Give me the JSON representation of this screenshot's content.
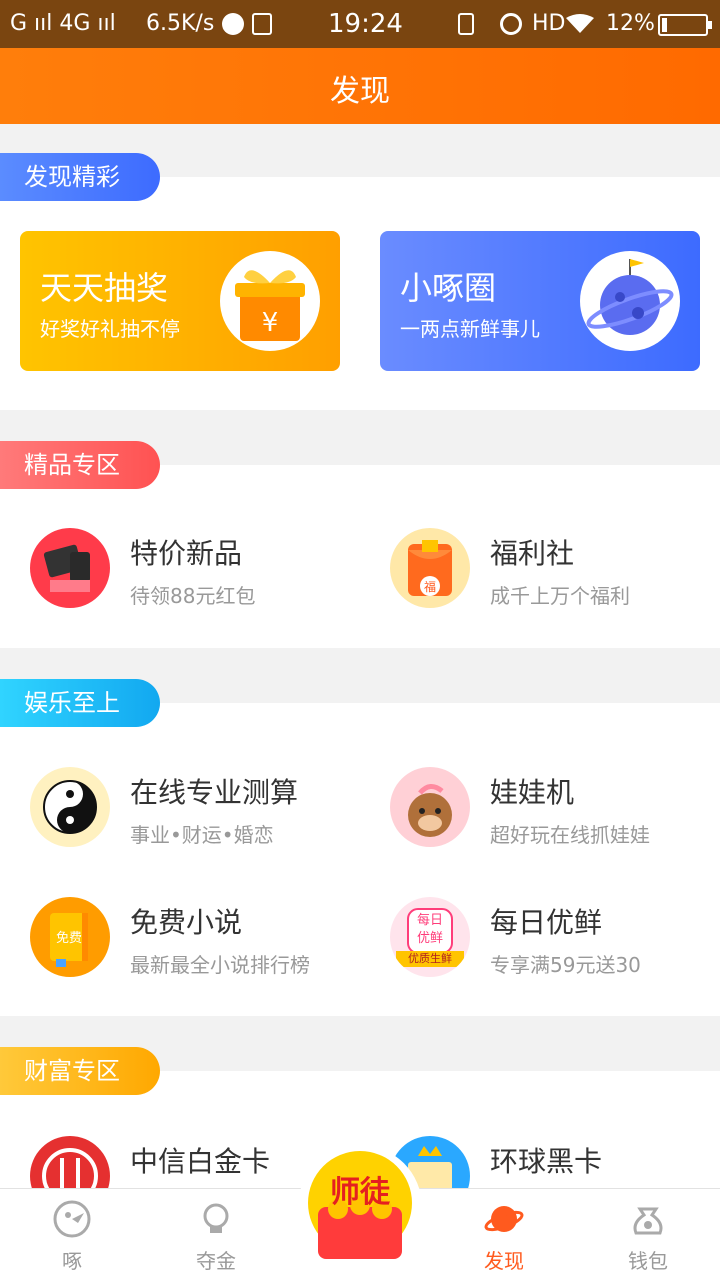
{
  "status_bar": {
    "signal_left": "G ııl 4G ııl",
    "speed": "6.5K/s",
    "time": "19:24",
    "hd": "HD",
    "battery": "12%",
    "battery_level": 0.12
  },
  "header": {
    "title": "发现"
  },
  "sections": {
    "discover": {
      "label": "发现精彩"
    },
    "premium": {
      "label": "精品专区"
    },
    "entertainment": {
      "label": "娱乐至上"
    },
    "wealth": {
      "label": "财富专区"
    }
  },
  "discover_cards": [
    {
      "title": "天天抽奖",
      "subtitle": "好奖好礼抽不停",
      "icon": "gift-icon",
      "color": "#ffb400"
    },
    {
      "title": "小啄圈",
      "subtitle": "一两点新鲜事儿",
      "icon": "planet-icon",
      "color": "#4a7bff"
    }
  ],
  "premium_items": [
    {
      "title": "特价新品",
      "subtitle": "待领88元红包",
      "icon": "gadgets-icon"
    },
    {
      "title": "福利社",
      "subtitle": "成千上万个福利",
      "icon": "red-envelope-icon"
    }
  ],
  "entertainment_items": [
    {
      "title": "在线专业测算",
      "subtitle": "事业•财运•婚恋",
      "icon": "yin-yang-icon"
    },
    {
      "title": "娃娃机",
      "subtitle": "超好玩在线抓娃娃",
      "icon": "plush-bear-icon"
    },
    {
      "title": "免费小说",
      "subtitle": "最新最全小说排行榜",
      "icon": "book-icon",
      "badge": "免费"
    },
    {
      "title": "每日优鲜",
      "subtitle": "专享满59元送30",
      "icon": "fresh-icon",
      "badge_top": "每日",
      "badge_mid": "优鲜",
      "ribbon": "优质生鲜"
    }
  ],
  "wealth_items": [
    {
      "title": "中信白金卡",
      "icon": "citic-logo-icon"
    },
    {
      "title": "环球黑卡",
      "icon": "crown-card-icon"
    }
  ],
  "center_button": {
    "label": "师徒",
    "icon": "coin-envelope-icon"
  },
  "tabs": [
    {
      "label": "啄",
      "icon": "bird-icon",
      "active": false
    },
    {
      "label": "夺金",
      "icon": "lightbulb-icon",
      "active": false
    },
    {
      "label": "发现",
      "icon": "planet-icon",
      "active": true
    },
    {
      "label": "钱包",
      "icon": "money-bag-icon",
      "active": false
    }
  ],
  "colors": {
    "header": "#ff7e0b",
    "active_tab": "#ff5a1e",
    "discover_pill": "#3d7bff",
    "premium_pill": "#ff5a5a",
    "entertainment_pill": "#20b8f0",
    "wealth_pill": "#ffb000"
  }
}
